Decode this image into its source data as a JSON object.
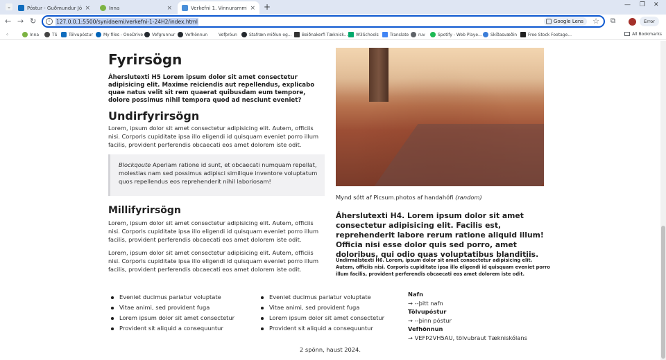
{
  "browser": {
    "tabs": [
      {
        "title": "Póstur - Guðmundur Jón Guðjó",
        "color": "#0f6cbd",
        "active": false
      },
      {
        "title": "Inna",
        "color": "#7cb342",
        "active": false
      },
      {
        "title": "Verkefni 1. Vinnurammi",
        "color": "#4a90d9",
        "active": true
      }
    ],
    "url": "127.0.0.1:5500/synidaemi/verkefni-1-24H2/index.html",
    "lens_label": "Google Lens",
    "error_label": "Error",
    "bookmarks": [
      {
        "label": "Inna",
        "color": "#7cb342"
      },
      {
        "label": "TS",
        "color": "#444444"
      },
      {
        "label": "Tölvupóstur",
        "color": "#0f6cbd"
      },
      {
        "label": "My files - OneDrive",
        "color": "#0364b8"
      },
      {
        "label": "Vefgrunnur",
        "color": "#24292f"
      },
      {
        "label": "Vefhönnun",
        "color": "#24292f"
      },
      {
        "label": "Vefþróun",
        "color": "#888888"
      },
      {
        "label": "Stafræn miðlun og...",
        "color": "#24292f"
      },
      {
        "label": "Beiðnakerfi Tæknisk...",
        "color": "#333333"
      },
      {
        "label": "W3Schools",
        "color": "#04aa6d"
      },
      {
        "label": "Translate",
        "color": "#4285f4"
      },
      {
        "label": "ruv",
        "color": "#5f6368"
      },
      {
        "label": "Spotify - Web Playe...",
        "color": "#1db954"
      },
      {
        "label": "Skíðasvæðin",
        "color": "#3b7dd8"
      },
      {
        "label": "Free Stock Footage...",
        "color": "#222222"
      }
    ],
    "all_bookmarks": "All Bookmarks"
  },
  "page": {
    "h1": "Fyrirsögn",
    "h5": "Áherslutexti H5 Lorem ipsum dolor sit amet consectetur adipisicing elit. Maxime reiciendis aut repellendus, explicabo quae natus velit sit rem quaerat quibusdam eum tempore, dolore possimus nihil tempora quod ad nesciunt eveniet?",
    "h2": "Undirfyrirsögn",
    "p1": "Lorem, ipsum dolor sit amet consectetur adipisicing elit. Autem, officiis nisi. Corporis cupiditate ipsa illo eligendi id quisquam eveniet porro illum facilis, provident perferendis obcaecati eos amet dolorem iste odit.",
    "quote_label": "Blockqoute",
    "quote_text": " Aperiam ratione id sunt, et obcaecati numquam repellat, molestias nam sed possimus adipisci similique inventore voluptatum quos repellendus eos reprehenderit nihil laboriosam!",
    "h3": "Millifyrirsögn",
    "p2": "Lorem, ipsum dolor sit amet consectetur adipisicing elit. Autem, officiis nisi. Corporis cupiditate ipsa illo eligendi id quisquam eveniet porro illum facilis, provident perferendis obcaecati eos amet dolorem iste odit.",
    "p3": "Lorem, ipsum dolor sit amet consectetur adipisicing elit. Autem, officiis nisi. Corporis cupiditate ipsa illo eligendi id quisquam eveniet porro illum facilis, provident perferendis obcaecati eos amet dolorem iste odit.",
    "caption_text": "Mynd sótt af Picsum.photos af handahófi ",
    "caption_em": "(random)",
    "h4": "Áherslutexti H4. Lorem ipsum dolor sit amet consectetur adipisicing elit. Facilis est, reprehenderit labore rerum ratione aliquid illum! Officia nisi esse dolor quis sed porro, amet doloribus, qui odio quas voluptatibus blanditiis.",
    "h6": "Undirmálstexti H6. Lorem, ipsum dolor sit amet consectetur adipisicing elit. Autem, officiis nisi. Corporis cupiditate ipsa illo eligendi id quisquam eveniet porro illum facilis, provident perferendis obcaecati eos amet dolorem iste odit.",
    "list1": [
      "Eveniet ducimus pariatur voluptate",
      "Vitae animi, sed provident fuga",
      "Lorem ipsum dolor sit amet consectetur",
      "Provident sit aliquid a consequuntur"
    ],
    "list2": [
      "Eveniet ducimus pariatur voluptate",
      "Vitae animi, sed provident fuga",
      "Lorem ipsum dolor sit amet consectetur",
      "Provident sit aliquid a consequuntur"
    ],
    "dl": [
      {
        "term": "Nafn",
        "def": "→ --þitt nafn"
      },
      {
        "term": "Tölvupóstur",
        "def": "→ --þinn póstur"
      },
      {
        "term": "Vefhönnun",
        "def": "→ VEFÞ2VH5AU, tölvubraut Tækniskólans"
      }
    ],
    "footer": "2 spönn, haust 2024."
  }
}
